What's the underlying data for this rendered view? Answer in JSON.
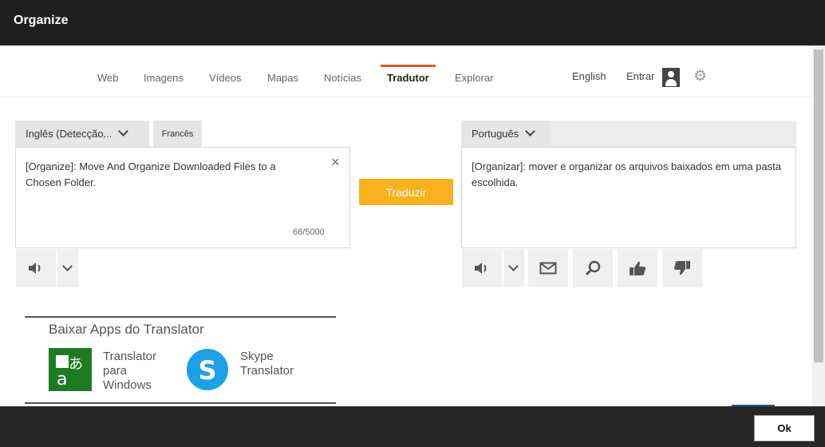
{
  "window": {
    "title": "Organize"
  },
  "nav": {
    "tabs": [
      "Web",
      "Imagens",
      "Vídeos",
      "Mapas",
      "Notícias",
      "Tradutor",
      "Explorar"
    ],
    "active": "Tradutor",
    "language_link": "English",
    "signin_label": "Entrar"
  },
  "source": {
    "language": "Inglês (Detecção...",
    "alt_language": "Francês",
    "text": "[Organize]: Move And Organize Downloaded Files to a Chosen Folder.",
    "char_count": "66/5000"
  },
  "translate_button": "Traduzir",
  "target": {
    "language": "Português",
    "text": "[Organizar]: mover e organizar os arquivos baixados em uma pasta escolhida."
  },
  "apps": {
    "title": "Baixar Apps do Translator",
    "items": [
      {
        "name": "Translator para Windows",
        "icon": "translator-icon",
        "color": "#1f7a24"
      },
      {
        "name": "Skype Translator",
        "icon": "skype-icon",
        "color": "#1da1e6"
      }
    ]
  },
  "footer": {
    "ok_label": "Ok"
  },
  "colors": {
    "accent": "#e8552a",
    "translate_button": "#f9b21d",
    "titlebar": "#1f1f1f"
  }
}
